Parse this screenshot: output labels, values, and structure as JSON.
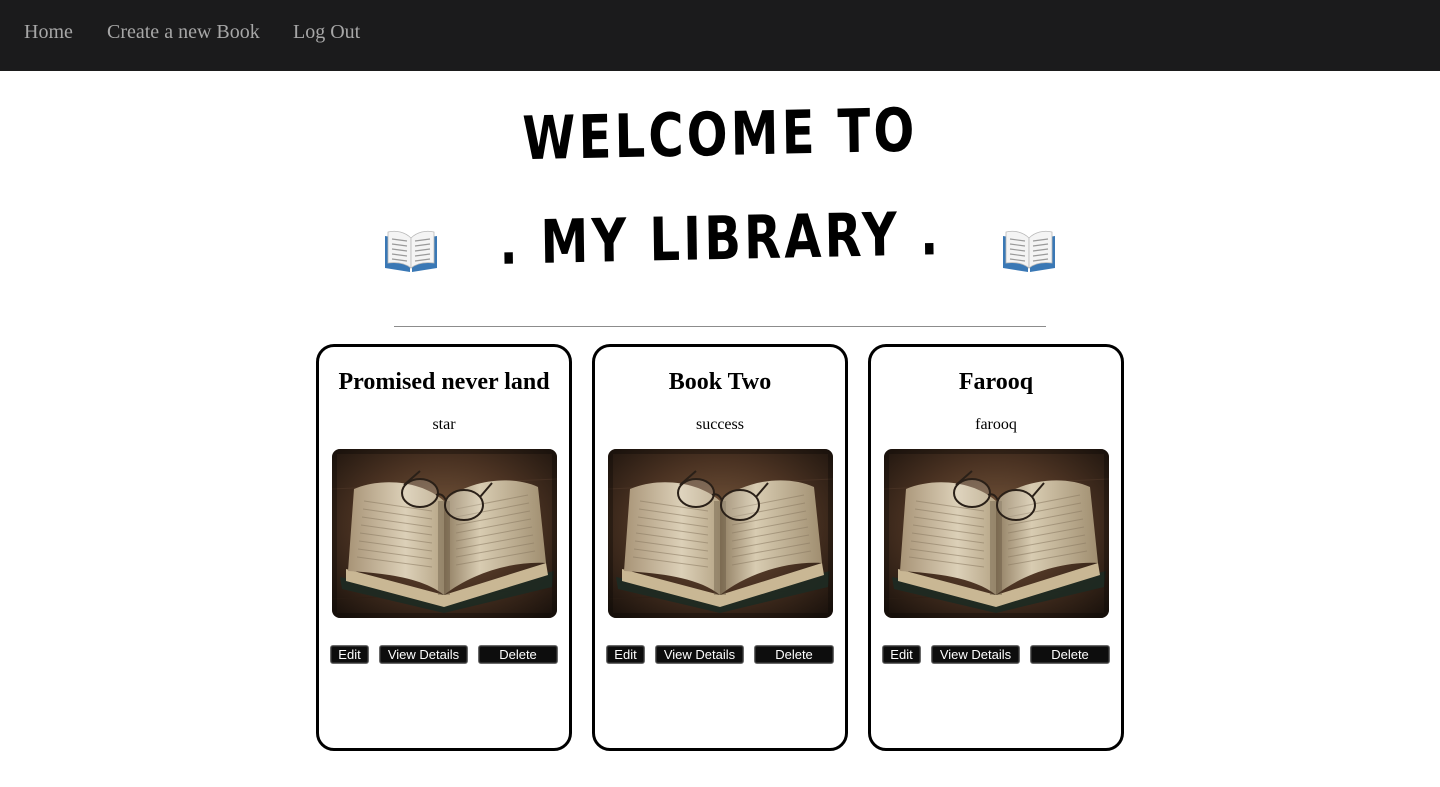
{
  "nav": {
    "items": [
      {
        "label": "Home"
      },
      {
        "label": "Create a new Book"
      },
      {
        "label": "Log Out"
      }
    ],
    "background": "#1b1b1c",
    "link_color": "#a7a7a7"
  },
  "hero": {
    "line1": "WELCOME TO",
    "line2": ". MY LIBRARY .",
    "icon": "open-book-emoji"
  },
  "books": [
    {
      "title": "Promised never land",
      "author": "star",
      "image": "open-book-with-glasses-photo"
    },
    {
      "title": "Book Two",
      "author": "success",
      "image": "open-book-with-glasses-photo"
    },
    {
      "title": "Farooq",
      "author": "farooq",
      "image": "open-book-with-glasses-photo"
    }
  ],
  "card_actions": {
    "edit": "Edit",
    "view": "View Details",
    "delete": "Delete"
  }
}
